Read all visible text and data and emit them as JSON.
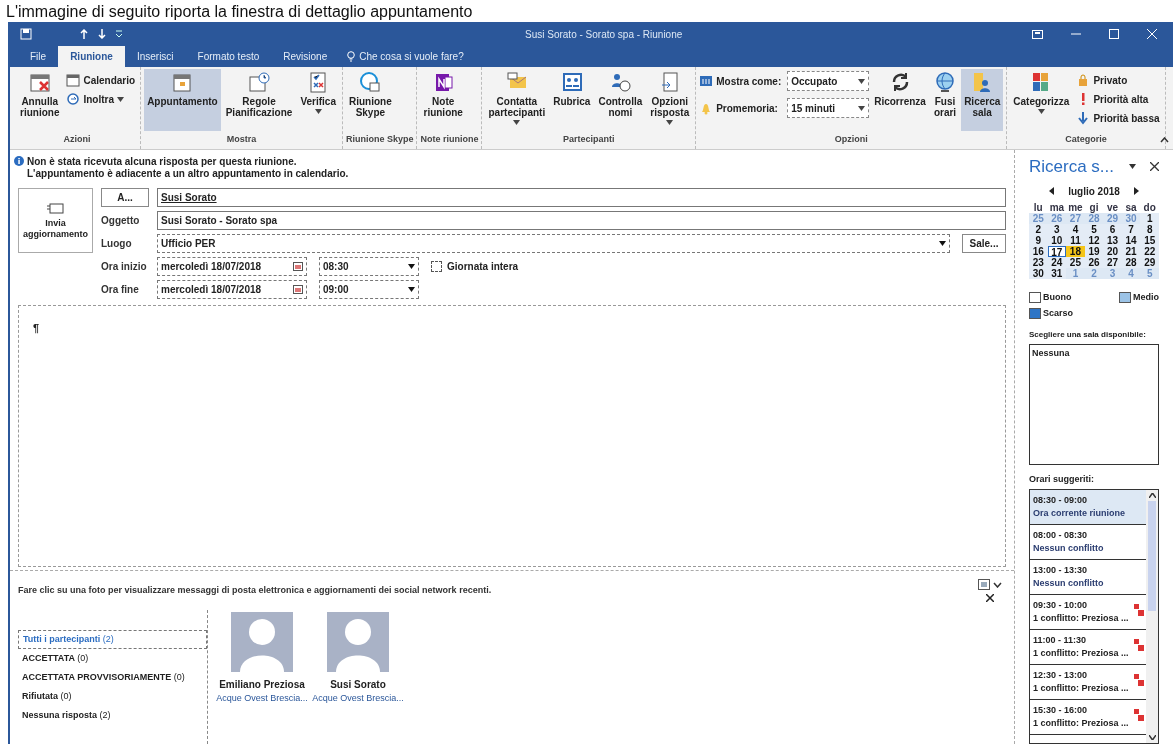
{
  "document_heading": "L'immagine di seguito riporta la finestra di dettaglio appuntamento",
  "window": {
    "title": "Susi Sorato - Sorato spa  -  Riunione"
  },
  "tabs": [
    {
      "label": "File",
      "selected": false
    },
    {
      "label": "Riunione",
      "selected": true
    },
    {
      "label": "Inserisci",
      "selected": false
    },
    {
      "label": "Formato testo",
      "selected": false
    },
    {
      "label": "Revisione",
      "selected": false
    }
  ],
  "tell_me": {
    "placeholder": "Che cosa si vuole fare?"
  },
  "ribbon": [
    {
      "name": "Azioni",
      "columns": [
        [
          {
            "kind": "large",
            "label": "Annulla\nriunione",
            "selected": false,
            "dropdown": false
          }
        ],
        [
          {
            "kind": "small",
            "label": "Calendario",
            "dropdown": false
          },
          {
            "kind": "small",
            "label": "Inoltra",
            "dropdown": true
          }
        ]
      ]
    },
    {
      "name": "Mostra",
      "columns": [
        [
          {
            "kind": "large",
            "label": "Appuntamento",
            "selected": true,
            "dropdown": false
          }
        ],
        [
          {
            "kind": "large",
            "label": "Regole\nPianificazione",
            "selected": false,
            "dropdown": false
          }
        ],
        [
          {
            "kind": "large",
            "label": "Verifica",
            "selected": false,
            "dropdown": true
          }
        ]
      ]
    },
    {
      "name": "Riunione Skype",
      "columns": [
        [
          {
            "kind": "large",
            "label": "Riunione\nSkype",
            "selected": false,
            "dropdown": false
          }
        ]
      ]
    },
    {
      "name": "Note riunione",
      "columns": [
        [
          {
            "kind": "large",
            "label": "Note\nriunione",
            "selected": false,
            "dropdown": false
          }
        ]
      ]
    },
    {
      "name": "Partecipanti",
      "columns": [
        [
          {
            "kind": "large",
            "label": "Contatta\npartecipanti",
            "selected": false,
            "dropdown": true
          }
        ],
        [
          {
            "kind": "large",
            "label": "Rubrica",
            "selected": false,
            "dropdown": false
          }
        ],
        [
          {
            "kind": "large",
            "label": "Controlla\nnomi",
            "selected": false,
            "dropdown": false
          }
        ],
        [
          {
            "kind": "large",
            "label": "Opzioni\nrisposta",
            "selected": false,
            "dropdown": true
          }
        ]
      ]
    },
    {
      "name": "Opzioni",
      "columns": [
        [
          {
            "kind": "combo",
            "label": "Mostra come:",
            "value": "Occupato"
          },
          {
            "kind": "combo",
            "label": "Promemoria:",
            "value": "15 minuti"
          }
        ],
        [
          {
            "kind": "large",
            "label": "Ricorrenza",
            "selected": false,
            "dropdown": false
          }
        ],
        [
          {
            "kind": "large",
            "label": "Fusi\norari",
            "selected": false,
            "dropdown": false
          }
        ],
        [
          {
            "kind": "large",
            "label": "Ricerca\nsala",
            "selected": true,
            "dropdown": false
          }
        ]
      ]
    },
    {
      "name": "Categorie",
      "columns": [
        [
          {
            "kind": "large",
            "label": "Categorizza",
            "selected": false,
            "dropdown": true
          }
        ],
        [
          {
            "kind": "small",
            "label": "Privato",
            "dropdown": false
          },
          {
            "kind": "small",
            "label": "Priorità alta",
            "dropdown": false
          },
          {
            "kind": "small",
            "label": "Priorità bassa",
            "dropdown": false
          }
        ]
      ]
    }
  ],
  "info": [
    "Non è stata ricevuta alcuna risposta per questa riunione.",
    "L'appuntamento è adiacente a un altro appuntamento in calendario."
  ],
  "send_button": "Invia\naggiornamento",
  "form": {
    "to_button": "A...",
    "to": "Susi Sorato",
    "subject_label": "Oggetto",
    "subject": "Susi Sorato - Sorato spa",
    "location_label": "Luogo",
    "location": "Ufficio PER",
    "rooms_button": "Sale...",
    "start_label": "Ora inizio",
    "start_date": "mercoledì 18/07/2018",
    "start_time": "08:30",
    "all_day": {
      "label": "Giornata intera",
      "checked": false
    },
    "end_label": "Ora fine",
    "end_date": "mercoledì 18/07/2018",
    "end_time": "09:00"
  },
  "body_text": "¶",
  "people_pane": {
    "hint": "Fare clic su una foto per visualizzare messaggi di posta elettronica e aggiornamenti dei social network recenti.",
    "filters": [
      {
        "label": "Tutti i partecipanti",
        "count": "(2)",
        "selected": true
      },
      {
        "label": "ACCETTATA",
        "count": "(0)",
        "selected": false
      },
      {
        "label": "ACCETTATA PROVVISORIAMENTE",
        "count": "(0)",
        "selected": false
      },
      {
        "label": "Rifiutata",
        "count": "(0)",
        "selected": false
      },
      {
        "label": "Nessuna risposta",
        "count": "(2)",
        "selected": false
      }
    ],
    "people": [
      {
        "name": "Emiliano Preziosa",
        "company": "Acque Ovest Brescia..."
      },
      {
        "name": "Susi Sorato",
        "company": "Acque Ovest Brescia..."
      }
    ]
  },
  "room_finder": {
    "title": "Ricerca s...",
    "month": "luglio 2018",
    "weekdays": [
      "lu",
      "ma",
      "me",
      "gi",
      "ve",
      "sa",
      "do"
    ],
    "days": [
      {
        "d": "25",
        "kind": "other"
      },
      {
        "d": "26",
        "kind": "other"
      },
      {
        "d": "27",
        "kind": "other"
      },
      {
        "d": "28",
        "kind": "other"
      },
      {
        "d": "29",
        "kind": "other"
      },
      {
        "d": "30",
        "kind": "other"
      },
      {
        "d": "1",
        "kind": "day"
      },
      {
        "d": "2",
        "kind": "day"
      },
      {
        "d": "3",
        "kind": "day"
      },
      {
        "d": "4",
        "kind": "day"
      },
      {
        "d": "5",
        "kind": "day"
      },
      {
        "d": "6",
        "kind": "day"
      },
      {
        "d": "7",
        "kind": "day"
      },
      {
        "d": "8",
        "kind": "day"
      },
      {
        "d": "9",
        "kind": "day"
      },
      {
        "d": "10",
        "kind": "day"
      },
      {
        "d": "11",
        "kind": "day"
      },
      {
        "d": "12",
        "kind": "day"
      },
      {
        "d": "13",
        "kind": "day"
      },
      {
        "d": "14",
        "kind": "day"
      },
      {
        "d": "15",
        "kind": "day"
      },
      {
        "d": "16",
        "kind": "day"
      },
      {
        "d": "17",
        "kind": "today"
      },
      {
        "d": "18",
        "kind": "selected"
      },
      {
        "d": "19",
        "kind": "day"
      },
      {
        "d": "20",
        "kind": "day"
      },
      {
        "d": "21",
        "kind": "day"
      },
      {
        "d": "22",
        "kind": "day"
      },
      {
        "d": "23",
        "kind": "day"
      },
      {
        "d": "24",
        "kind": "day"
      },
      {
        "d": "25",
        "kind": "day"
      },
      {
        "d": "26",
        "kind": "day"
      },
      {
        "d": "27",
        "kind": "day"
      },
      {
        "d": "28",
        "kind": "day"
      },
      {
        "d": "29",
        "kind": "day"
      },
      {
        "d": "30",
        "kind": "day"
      },
      {
        "d": "31",
        "kind": "day"
      },
      {
        "d": "1",
        "kind": "other"
      },
      {
        "d": "2",
        "kind": "other"
      },
      {
        "d": "3",
        "kind": "other"
      },
      {
        "d": "4",
        "kind": "other"
      },
      {
        "d": "5",
        "kind": "other"
      }
    ],
    "legend": [
      {
        "label": "Buono",
        "color": "#ffffff"
      },
      {
        "label": "Medio",
        "color": "#9cc3e6"
      },
      {
        "label": "Scarso",
        "color": "#2e75c6"
      }
    ],
    "rooms_label": "Scegliere una sala disponibile:",
    "rooms": [
      "Nessuna"
    ],
    "suggested_label": "Orari suggeriti:",
    "suggested": [
      {
        "time": "08:30 - 09:00",
        "note": "Ora corrente riunione",
        "conflict": false,
        "selected": true
      },
      {
        "time": "08:00 - 08:30",
        "note": "Nessun conflitto",
        "conflict": false,
        "selected": false
      },
      {
        "time": "13:00 - 13:30",
        "note": "Nessun conflitto",
        "conflict": false,
        "selected": false
      },
      {
        "time": "09:30 - 10:00",
        "note": "1 conflitto: Preziosa ...",
        "conflict": true,
        "selected": false
      },
      {
        "time": "11:00 - 11:30",
        "note": "1 conflitto: Preziosa ...",
        "conflict": true,
        "selected": false
      },
      {
        "time": "12:30 - 13:00",
        "note": "1 conflitto: Preziosa ...",
        "conflict": true,
        "selected": false
      },
      {
        "time": "15:30 - 16:00",
        "note": "1 conflitto: Preziosa ...",
        "conflict": true,
        "selected": false
      }
    ]
  }
}
